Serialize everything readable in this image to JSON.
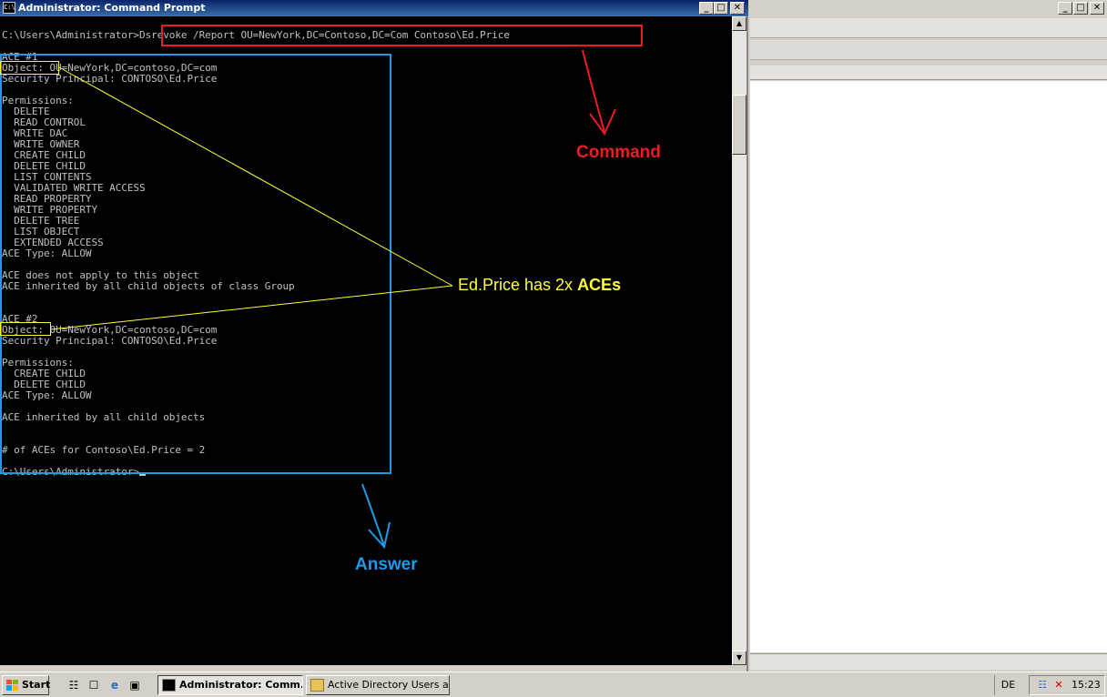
{
  "cmd_window": {
    "title": "Administrator: Command Prompt",
    "icon": "cmd-icon",
    "console_lines": [
      "C:\\Users\\Administrator>Dsrevoke /Report OU=NewYork,DC=Contoso,DC=Com Contoso\\Ed.Price",
      "",
      "ACE #1",
      "Object: OU=NewYork,DC=contoso,DC=com",
      "Security Principal: CONTOSO\\Ed.Price",
      "",
      "Permissions:",
      "  DELETE",
      "  READ CONTROL",
      "  WRITE DAC",
      "  WRITE OWNER",
      "  CREATE CHILD",
      "  DELETE CHILD",
      "  LIST CONTENTS",
      "  VALIDATED WRITE ACCESS",
      "  READ PROPERTY",
      "  WRITE PROPERTY",
      "  DELETE TREE",
      "  LIST OBJECT",
      "  EXTENDED ACCESS",
      "ACE Type: ALLOW",
      "",
      "ACE does not apply to this object",
      "ACE inherited by all child objects of class Group",
      "",
      "",
      "ACE #2",
      "Object: OU=NewYork,DC=contoso,DC=com",
      "Security Principal: CONTOSO\\Ed.Price",
      "",
      "Permissions:",
      "  CREATE CHILD",
      "  DELETE CHILD",
      "ACE Type: ALLOW",
      "",
      "ACE inherited by all child objects",
      "",
      "",
      "# of ACEs for Contoso\\Ed.Price = 2",
      "",
      "C:\\Users\\Administrator>"
    ]
  },
  "annotations": {
    "command_label": "Command",
    "answer_label": "Answer",
    "aces_label_prefix": "Ed.Price has 2x ",
    "aces_label_bold": "ACEs",
    "colors": {
      "command": "#ee1c24",
      "answer": "#1e9ae6",
      "aces": "#ffff33"
    }
  },
  "taskbar": {
    "start_label": "Start",
    "quick_launch_icons": [
      "server-manager-icon",
      "computer-icon",
      "ie-icon",
      "show-desktop-icon"
    ],
    "tasks": [
      {
        "label": "Administrator: Comm...",
        "icon": "cmd-icon",
        "active": true
      },
      {
        "label": "Active Directory Users a...",
        "icon": "ad-users-icon",
        "active": false
      }
    ],
    "language": "DE",
    "tray_icons": [
      "network-icon",
      "volume-muted-icon"
    ],
    "clock": "15:23"
  }
}
